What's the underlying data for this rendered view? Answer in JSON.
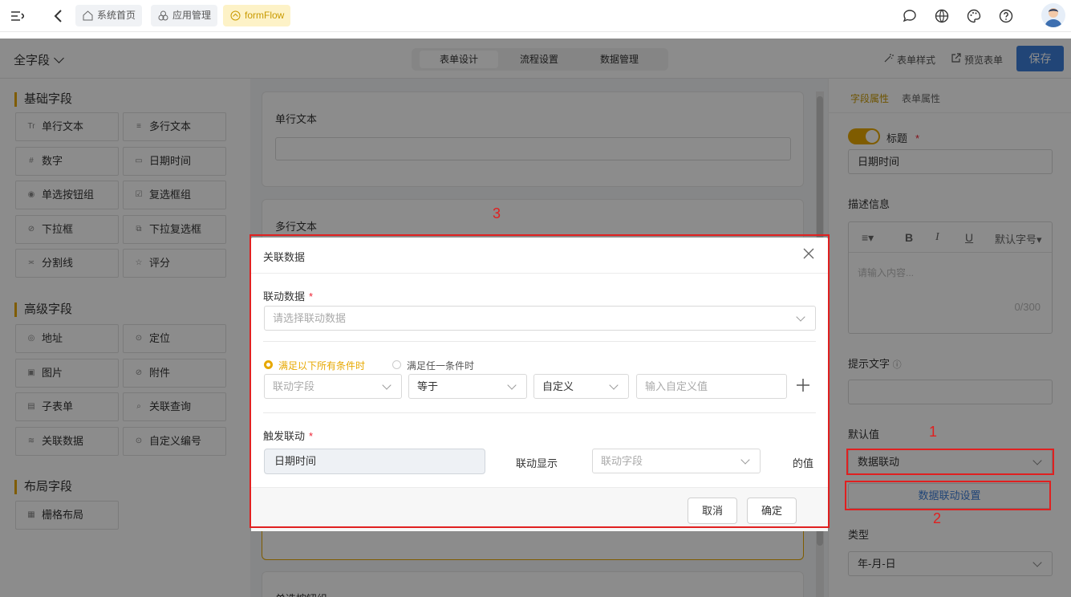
{
  "topbar": {
    "breadcrumbs": [
      {
        "label": "系统首页",
        "icon": "home-icon"
      },
      {
        "label": "应用管理",
        "icon": "apps-icon"
      },
      {
        "label": "formFlow",
        "icon": "flow-icon"
      }
    ],
    "icons": [
      "message-icon",
      "globe-icon",
      "palette-icon",
      "help-icon",
      "avatar"
    ]
  },
  "subbar": {
    "form_name": "全字段",
    "tabs": [
      "表单设计",
      "流程设置",
      "数据管理"
    ],
    "active_tab": "表单设计",
    "form_style": "表单样式",
    "preview": "预览表单",
    "save": "保存"
  },
  "left": {
    "groups": [
      {
        "title": "基础字段",
        "items": [
          "单行文本",
          "多行文本",
          "数字",
          "日期时间",
          "单选按钮组",
          "复选框组",
          "下拉框",
          "下拉复选框",
          "分割线",
          "评分"
        ]
      },
      {
        "title": "高级字段",
        "items": [
          "地址",
          "定位",
          "图片",
          "附件",
          "子表单",
          "关联查询",
          "关联数据",
          "自定义编号"
        ]
      },
      {
        "title": "布局字段",
        "items": [
          "栅格布局"
        ]
      }
    ],
    "icons": [
      "Tr",
      "≡",
      "#",
      "▭",
      "◉",
      "☑",
      "⊘",
      "⧉",
      "≍",
      "☆",
      "◎",
      "⊙",
      "▣",
      "⊘",
      "▤",
      "⌕",
      "≋",
      "⊙",
      "▦"
    ]
  },
  "canvas": {
    "cards": [
      "单行文本",
      "多行文本",
      "单选按钮组"
    ]
  },
  "right": {
    "tabs": [
      "字段属性",
      "表单属性"
    ],
    "title_label": "标题",
    "title_value": "日期时间",
    "desc_label": "描述信息",
    "editor_font": "默认字号",
    "editor_placeholder": "请输入内容...",
    "editor_count": "0/300",
    "hint_label": "提示文字",
    "default_label": "默认值",
    "default_value": "数据联动",
    "link_settings": "数据联动设置",
    "type_label": "类型",
    "type_value": "年-月-日"
  },
  "modal": {
    "title": "关联数据",
    "link_data_label": "联动数据",
    "link_data_placeholder": "请选择联动数据",
    "radio_all": "满足以下所有条件时",
    "radio_any": "满足任一条件时",
    "cond_field_placeholder": "联动字段",
    "cond_op": "等于",
    "cond_type": "自定义",
    "cond_value_placeholder": "输入自定义值",
    "trigger_label": "触发联动",
    "trigger_value": "日期时间",
    "show_label": "联动显示",
    "show_field_placeholder": "联动字段",
    "value_suffix": "的值",
    "cancel": "取消",
    "confirm": "确定"
  },
  "annotations": [
    "1",
    "2",
    "3"
  ],
  "colors": {
    "accent": "#e7a800",
    "primary": "#3d7fd9",
    "annotation": "#e02020"
  }
}
